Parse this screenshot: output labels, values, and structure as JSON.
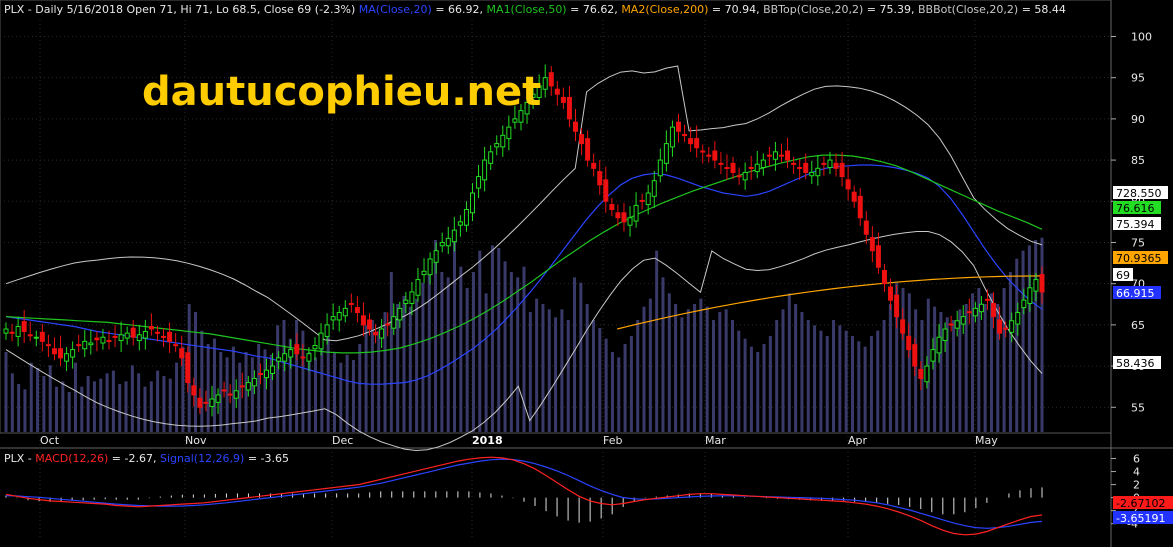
{
  "watermark": "dautucophieu.net",
  "price_panel": {
    "symbol": "PLX",
    "header_info": " - Daily 5/16/2018 Open 71, Hi 71, Lo 68.5, Close 69 (-2.3%) ",
    "legend": [
      {
        "name": "MA(Close,20)",
        "value": " = 66.92, ",
        "color": "#2a44ff"
      },
      {
        "name": "MA1(Close,50)",
        "value": " = 76.62, ",
        "color": "#1fc41f"
      },
      {
        "name": "MA2(Close,200)",
        "value": " = 70.94, ",
        "color": "#ffa500"
      },
      {
        "name": "BBTop(Close,20,2)",
        "value": " = 75.39, ",
        "color": "#c8c8c8"
      },
      {
        "name": "BBBot(Close,20,2)",
        "value": " = 58.44",
        "color": "#c8c8c8"
      }
    ],
    "y_ticks": [
      "100",
      "95",
      "90",
      "85",
      "80",
      "75",
      "70",
      "65",
      "60",
      "55"
    ],
    "month_labels": [
      "Oct",
      "Nov",
      "Dec",
      "2018",
      "Feb",
      "Mar",
      "Apr",
      "May"
    ],
    "value_tags": [
      {
        "text": "728.550",
        "bg": "#ffffff",
        "fg": "#000000"
      },
      {
        "text": "76.616",
        "bg": "#22dd22",
        "fg": "#000000"
      },
      {
        "text": "75.394",
        "bg": "#ffffff",
        "fg": "#000000"
      },
      {
        "text": "70.9365",
        "bg": "#ffa500",
        "fg": "#000000"
      },
      {
        "text": "69",
        "bg": "#ffffff",
        "fg": "#000000"
      },
      {
        "text": "66.915",
        "bg": "#2233ff",
        "fg": "#ffffff"
      },
      {
        "text": "58.436",
        "bg": "#ffffff",
        "fg": "#000000"
      }
    ]
  },
  "macd_panel": {
    "symbol": "PLX",
    "legend": [
      {
        "name": "MACD(12,26)",
        "value": " = -2.67, ",
        "color": "#ff2222"
      },
      {
        "name": "Signal(12,26,9)",
        "value": " = -3.65",
        "color": "#2a44ff"
      }
    ],
    "y_ticks": [
      "6",
      "4",
      "2",
      "0",
      "-2",
      "-4"
    ],
    "value_tags": [
      {
        "text": "-2.67102",
        "bg": "#ff1a1a",
        "fg": "#000000"
      },
      {
        "text": "-3.65191",
        "bg": "#2233ff",
        "fg": "#ffffff"
      }
    ]
  },
  "chart_data": {
    "type": "candlestick",
    "symbol": "PLX",
    "period": "Daily",
    "last_bar": {
      "date": "5/16/2018",
      "open": 71,
      "high": 71,
      "low": 68.5,
      "close": 69,
      "change_pct": -2.3
    },
    "indicators": {
      "MA20": 66.92,
      "MA50": 76.62,
      "MA200": 70.94,
      "BBTop": 75.39,
      "BBBot": 58.44,
      "MACD": -2.67,
      "Signal": -3.65,
      "volume_last": 728.55
    },
    "price_ylim": [
      52,
      102
    ],
    "macd_ylim": [
      -6.5,
      7
    ],
    "x_months": [
      "Oct",
      "Nov",
      "Dec",
      "2018",
      "Feb",
      "Mar",
      "Apr",
      "May"
    ],
    "closes": [
      64.5,
      64,
      64.8,
      64.2,
      63.8,
      63.5,
      63,
      62.5,
      61.5,
      61,
      61.5,
      62,
      62.5,
      63,
      62.8,
      63.2,
      63.5,
      63,
      63.5,
      63.8,
      64,
      63.5,
      63.8,
      64.2,
      64.5,
      64,
      63.5,
      63,
      62.5,
      61,
      58,
      56.5,
      55,
      55.5,
      56,
      56.5,
      57,
      56.5,
      57,
      57.5,
      58,
      58.5,
      59,
      59.5,
      60,
      61,
      61.5,
      62,
      61.5,
      61,
      61.5,
      62.5,
      64,
      65,
      66,
      66.5,
      67,
      67.5,
      66.5,
      65,
      64.5,
      63.8,
      64.5,
      65,
      66,
      67,
      68,
      69,
      70.5,
      71.5,
      73,
      74,
      75,
      75.5,
      76.5,
      77.5,
      79,
      81,
      83,
      85,
      86,
      87,
      88,
      89,
      90,
      91,
      92,
      93,
      94,
      95,
      94,
      93,
      92,
      90,
      88.5,
      87,
      85,
      84,
      82,
      80,
      79,
      78,
      77.5,
      78,
      79.5,
      80,
      81,
      82.5,
      85,
      87,
      89,
      88.5,
      88,
      87,
      86.5,
      86,
      85.5,
      85,
      84.5,
      84,
      83.5,
      83,
      83.5,
      84,
      84.5,
      85,
      85.5,
      86,
      85.5,
      85,
      84.5,
      84,
      83.5,
      83.5,
      84,
      84.5,
      85,
      84,
      83,
      81.5,
      80,
      78,
      76,
      74,
      72,
      70,
      68,
      66,
      64,
      62,
      60,
      58.5,
      60,
      62,
      63.5,
      64.5,
      65,
      65.5,
      66,
      66.5,
      67,
      67.5,
      68,
      66,
      64,
      64.5,
      65.5,
      66.5,
      68,
      69.5,
      70.5,
      69
    ],
    "ma20": [
      66,
      65.8,
      65.6,
      65.4,
      65.2,
      65,
      64.8,
      64.5,
      64.2,
      64,
      63.8,
      63.6,
      63.4,
      63.2,
      63,
      62.8,
      62.6,
      62.4,
      62.2,
      62,
      61.8,
      61.5,
      61.2,
      61,
      60.6,
      60.2,
      59.8,
      59.4,
      59,
      58.6,
      58.2,
      57.9,
      57.8,
      57.8,
      57.9,
      58,
      58.3,
      58.8,
      59.5,
      60.3,
      61.2,
      62.1,
      63.2,
      64.4,
      65.8,
      67.3,
      68.9,
      70.6,
      72.4,
      74.2,
      76,
      77.8,
      79.4,
      80.8,
      82,
      82.8,
      83.2,
      83.4,
      83.2,
      82.8,
      82.3,
      81.8,
      81.4,
      81,
      80.8,
      80.6,
      80.8,
      81.2,
      81.8,
      82.4,
      83,
      83.6,
      84,
      84.2,
      84.3,
      84.4,
      84.4,
      84.3,
      84.1,
      83.8,
      83.4,
      82.8,
      81.8,
      80.3,
      78.4,
      76.3,
      74.2,
      72.3,
      70.6,
      69.2,
      67.9,
      66.9
    ],
    "ma50": [
      66,
      65.9,
      65.8,
      65.7,
      65.6,
      65.5,
      65.4,
      65.3,
      65.1,
      64.9,
      64.7,
      64.5,
      64.3,
      64.1,
      63.9,
      63.6,
      63.3,
      63,
      62.7,
      62.4,
      62.1,
      61.9,
      61.7,
      61.6,
      61.6,
      61.7,
      61.9,
      62.2,
      62.7,
      63.3,
      64,
      64.8,
      65.7,
      66.7,
      67.8,
      69,
      70.2,
      71.5,
      72.8,
      74,
      75.2,
      76.3,
      77.3,
      78.2,
      79,
      79.8,
      80.5,
      81.2,
      81.8,
      82.4,
      83,
      83.6,
      84.1,
      84.6,
      85,
      85.4,
      85.6,
      85.6,
      85.5,
      85.2,
      84.8,
      84.3,
      83.6,
      82.8,
      82,
      81.2,
      80.4,
      79.6,
      78.8,
      78.1,
      77.4,
      76.6
    ],
    "volume": [
      300,
      220,
      180,
      160,
      260,
      240,
      210,
      250,
      170,
      190,
      150,
      260,
      170,
      210,
      190,
      200,
      220,
      230,
      180,
      190,
      250,
      220,
      170,
      190,
      230,
      210,
      200,
      260,
      320,
      480,
      450,
      380,
      330,
      350,
      300,
      280,
      320,
      260,
      300,
      280,
      330,
      310,
      290,
      400,
      420,
      350,
      420,
      380,
      300,
      280,
      320,
      360,
      300,
      260,
      290,
      270,
      330,
      400,
      420,
      380,
      450,
      600,
      480,
      510,
      470,
      500,
      560,
      650,
      720,
      600,
      580,
      750,
      620,
      540,
      600,
      680,
      520,
      700,
      690,
      640,
      600,
      580,
      620,
      450,
      500,
      480,
      460,
      430,
      460,
      420,
      580,
      560,
      480,
      420,
      390,
      350,
      300,
      280,
      330,
      360,
      420,
      470,
      500,
      680,
      580,
      520,
      480,
      430,
      460,
      480,
      500,
      470,
      420,
      450,
      460,
      420,
      380,
      350,
      320,
      300,
      330,
      360,
      420,
      460,
      520,
      480,
      450,
      420,
      400,
      380,
      360,
      420,
      400,
      380,
      360,
      340,
      320,
      360,
      380,
      420,
      480,
      560,
      540,
      520,
      460,
      420,
      500,
      470,
      450,
      430,
      420,
      460,
      480,
      520,
      540,
      480,
      520,
      480,
      540,
      600,
      650,
      680,
      700,
      720,
      728.55
    ],
    "macd": [
      0.5,
      0.2,
      -0.1,
      -0.3,
      -0.5,
      -0.6,
      -0.7,
      -0.8,
      -0.9,
      -1,
      -1.2,
      -1.3,
      -1.4,
      -1.3,
      -1.2,
      -1.1,
      -1,
      -0.9,
      -0.8,
      -0.6,
      -0.4,
      -0.2,
      0,
      0.2,
      0.4,
      0.6,
      0.8,
      1,
      1.2,
      1.4,
      1.6,
      1.8,
      2,
      2.4,
      2.8,
      3.2,
      3.6,
      4,
      4.4,
      4.8,
      5.2,
      5.6,
      5.9,
      6.1,
      6.2,
      6.1,
      5.8,
      5.2,
      4.4,
      3.4,
      2.3,
      1.2,
      0.2,
      -0.5,
      -0.9,
      -1.1,
      -0.9,
      -0.6,
      -0.3,
      -0.1,
      0.1,
      0.3,
      0.5,
      0.6,
      0.6,
      0.5,
      0.4,
      0.3,
      0.2,
      0.1,
      0,
      -0.1,
      -0.2,
      -0.3,
      -0.4,
      -0.5,
      -0.6,
      -0.8,
      -1,
      -1.3,
      -1.7,
      -2.2,
      -2.8,
      -3.5,
      -4.3,
      -5,
      -5.5,
      -5.7,
      -5.6,
      -5.2,
      -4.6,
      -4,
      -3.4,
      -2.9,
      -2.67
    ],
    "signal": [
      0.3,
      0.25,
      0.15,
      0.05,
      -0.1,
      -0.25,
      -0.4,
      -0.55,
      -0.7,
      -0.85,
      -1,
      -1.1,
      -1.2,
      -1.25,
      -1.3,
      -1.3,
      -1.28,
      -1.2,
      -1.1,
      -0.95,
      -0.8,
      -0.6,
      -0.4,
      -0.2,
      0,
      0.2,
      0.4,
      0.6,
      0.8,
      1,
      1.2,
      1.4,
      1.6,
      1.9,
      2.2,
      2.6,
      3,
      3.4,
      3.8,
      4.2,
      4.6,
      5,
      5.3,
      5.6,
      5.8,
      5.9,
      5.85,
      5.6,
      5.2,
      4.7,
      4.1,
      3.4,
      2.6,
      1.8,
      1.1,
      0.5,
      0,
      -0.2,
      -0.25,
      -0.2,
      -0.1,
      0,
      0.1,
      0.2,
      0.25,
      0.28,
      0.28,
      0.25,
      0.2,
      0.15,
      0.1,
      0.05,
      0,
      -0.05,
      -0.1,
      -0.2,
      -0.3,
      -0.4,
      -0.6,
      -0.8,
      -1.1,
      -1.5,
      -1.9,
      -2.4,
      -2.9,
      -3.4,
      -3.9,
      -4.3,
      -4.6,
      -4.7,
      -4.6,
      -4.4,
      -4.1,
      -3.8,
      -3.65
    ]
  }
}
